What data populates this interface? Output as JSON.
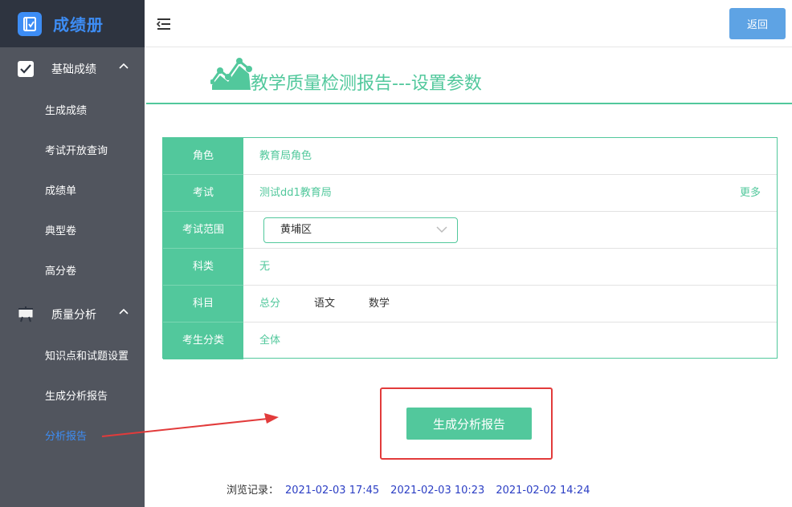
{
  "app": {
    "logo_text": "成绩册"
  },
  "sidebar": {
    "groups": [
      {
        "label": "基础成绩",
        "items": [
          "生成成绩",
          "考试开放查询",
          "成绩单",
          "典型卷",
          "高分卷"
        ]
      },
      {
        "label": "质量分析",
        "items": [
          "知识点和试题设置",
          "生成分析报告",
          "分析报告"
        ]
      }
    ],
    "active_item": "分析报告"
  },
  "header": {
    "back_label": "返回"
  },
  "page": {
    "title": "教学质量检测报告---设置参数"
  },
  "form": {
    "rows": [
      {
        "label": "角色",
        "value": "教育局角色"
      },
      {
        "label": "考试",
        "value": "测试dd1教育局",
        "more": "更多"
      },
      {
        "label": "考试范围",
        "select_value": "黄埔区"
      },
      {
        "label": "科类",
        "value": "无"
      },
      {
        "label": "科目",
        "subjects": [
          "总分",
          "语文",
          "数学"
        ],
        "selected_subject": "总分"
      },
      {
        "label": "考生分类",
        "value": "全体"
      }
    ]
  },
  "actions": {
    "generate_label": "生成分析报告"
  },
  "history": {
    "label": "浏览记录：",
    "records": [
      "2021-02-03 17:45",
      "2021-02-03 10:23",
      "2021-02-02 14:24"
    ]
  },
  "colors": {
    "accent": "#52c89c",
    "sidebar_bg": "#51555e",
    "logo_bg": "#2e3440",
    "brand_blue": "#3d8df5",
    "highlight_red": "#e23b3b"
  },
  "icons": {
    "logo": "book-icon",
    "group1": "checkbox-icon",
    "group2": "presentation-board-icon",
    "title": "chart-line-icon"
  }
}
